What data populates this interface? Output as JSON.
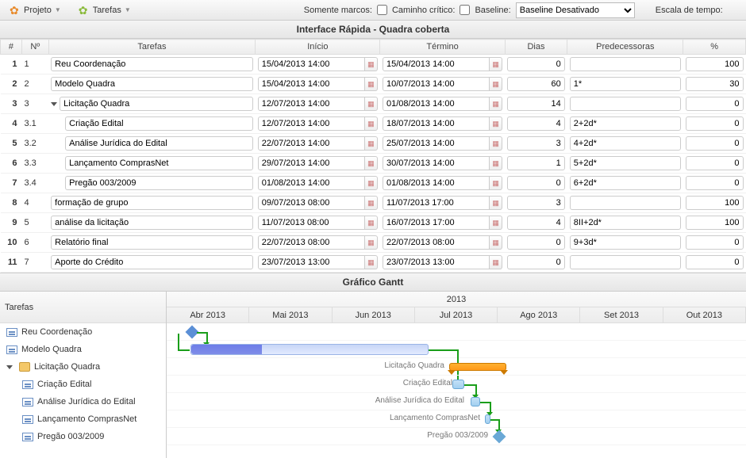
{
  "toolbar": {
    "projeto": "Projeto",
    "tarefas": "Tarefas"
  },
  "filters": {
    "somente_marcos": "Somente marcos:",
    "caminho_critico": "Caminho crítico:",
    "baseline_label": "Baseline:",
    "baseline_value": "Baseline Desativado",
    "escala_label": "Escala de tempo:"
  },
  "title": "Interface Rápida - Quadra coberta",
  "cols": {
    "hash": "#",
    "no": "Nº",
    "tarefas": "Tarefas",
    "inicio": "Início",
    "termino": "Término",
    "dias": "Dias",
    "predecessoras": "Predecessoras",
    "pct": "%"
  },
  "rows": [
    {
      "i": "1",
      "no": "1",
      "indent": 0,
      "tri": false,
      "name": "Reu Coordenação",
      "ini": "15/04/2013 14:00",
      "fim": "15/04/2013 14:00",
      "dias": "0",
      "pred": "",
      "pct": "100"
    },
    {
      "i": "2",
      "no": "2",
      "indent": 0,
      "tri": false,
      "name": "Modelo Quadra",
      "ini": "15/04/2013 14:00",
      "fim": "10/07/2013 14:00",
      "dias": "60",
      "pred": "1*",
      "pct": "30"
    },
    {
      "i": "3",
      "no": "3",
      "indent": 0,
      "tri": true,
      "name": "Licitação Quadra",
      "ini": "12/07/2013 14:00",
      "fim": "01/08/2013 14:00",
      "dias": "14",
      "pred": "",
      "pct": "0"
    },
    {
      "i": "4",
      "no": "3.1",
      "indent": 1,
      "tri": false,
      "name": "Criação Edital",
      "ini": "12/07/2013 14:00",
      "fim": "18/07/2013 14:00",
      "dias": "4",
      "pred": "2+2d*",
      "pct": "0"
    },
    {
      "i": "5",
      "no": "3.2",
      "indent": 1,
      "tri": false,
      "name": "Análise Jurídica do Edital",
      "ini": "22/07/2013 14:00",
      "fim": "25/07/2013 14:00",
      "dias": "3",
      "pred": "4+2d*",
      "pct": "0"
    },
    {
      "i": "6",
      "no": "3.3",
      "indent": 1,
      "tri": false,
      "name": "Lançamento ComprasNet",
      "ini": "29/07/2013 14:00",
      "fim": "30/07/2013 14:00",
      "dias": "1",
      "pred": "5+2d*",
      "pct": "0"
    },
    {
      "i": "7",
      "no": "3.4",
      "indent": 1,
      "tri": false,
      "name": "Pregão 003/2009",
      "ini": "01/08/2013 14:00",
      "fim": "01/08/2013 14:00",
      "dias": "0",
      "pred": "6+2d*",
      "pct": "0"
    },
    {
      "i": "8",
      "no": "4",
      "indent": 0,
      "tri": false,
      "name": "formação de grupo",
      "ini": "09/07/2013 08:00",
      "fim": "11/07/2013 17:00",
      "dias": "3",
      "pred": "",
      "pct": "100"
    },
    {
      "i": "9",
      "no": "5",
      "indent": 0,
      "tri": false,
      "name": "análise da licitação",
      "ini": "11/07/2013 08:00",
      "fim": "16/07/2013 17:00",
      "dias": "4",
      "pred": "8II+2d*",
      "pct": "100"
    },
    {
      "i": "10",
      "no": "6",
      "indent": 0,
      "tri": false,
      "name": "Relatório final",
      "ini": "22/07/2013 08:00",
      "fim": "22/07/2013 08:00",
      "dias": "0",
      "pred": "9+3d*",
      "pct": "0"
    },
    {
      "i": "11",
      "no": "7",
      "indent": 0,
      "tri": false,
      "name": "Aporte do Crédito",
      "ini": "23/07/2013 13:00",
      "fim": "23/07/2013 13:00",
      "dias": "0",
      "pred": "",
      "pct": "0"
    }
  ],
  "gantt": {
    "title": "Gráfico Gantt",
    "year": "2013",
    "months": [
      "Abr 2013",
      "Mai 2013",
      "Jun 2013",
      "Jul 2013",
      "Ago 2013",
      "Set 2013",
      "Out 2013"
    ],
    "left_header": "Tarefas",
    "tree": [
      {
        "label": "Reu Coordenação",
        "type": "task",
        "child": false
      },
      {
        "label": "Modelo Quadra",
        "type": "task",
        "child": false
      },
      {
        "label": "Licitação Quadra",
        "type": "folder",
        "child": false
      },
      {
        "label": "Criação Edital",
        "type": "task",
        "child": true
      },
      {
        "label": "Análise Jurídica do Edital",
        "type": "task",
        "child": true
      },
      {
        "label": "Lançamento ComprasNet",
        "type": "task",
        "child": true
      },
      {
        "label": "Pregão 003/2009",
        "type": "task",
        "child": true
      }
    ],
    "labels": {
      "licitacao": "Licitação Quadra",
      "criacao": "Criação Edital",
      "analise": "Análise Jurídica do Edital",
      "lancamento": "Lançamento ComprasNet",
      "pregao": "Pregão 003/2009"
    }
  }
}
